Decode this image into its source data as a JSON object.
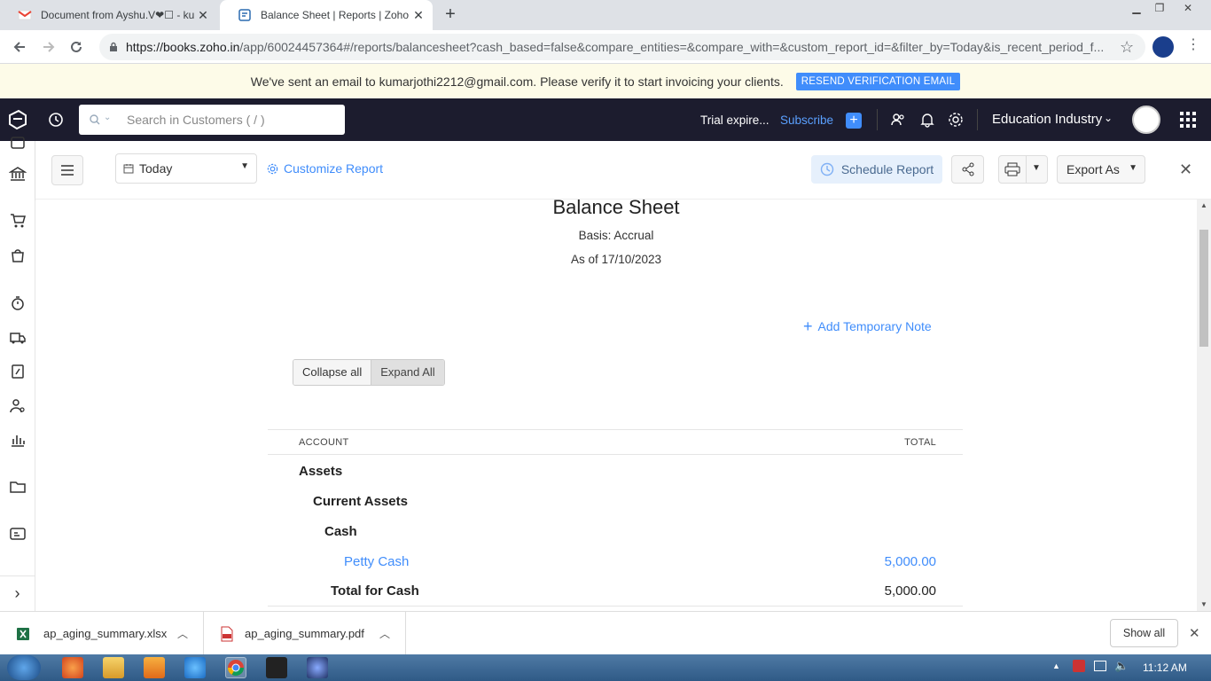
{
  "browser": {
    "tabs": [
      {
        "title": "Document from Ayshu.V❤☐ - ku",
        "active": false
      },
      {
        "title": "Balance Sheet | Reports | Zoho Bo",
        "active": true
      }
    ],
    "url_host": "https://books.zoho.in",
    "url_path": "/app/60024457364#/reports/balancesheet?cash_based=false&compare_entities=&compare_with=&custom_report_id=&filter_by=Today&is_recent_period_f..."
  },
  "banner": {
    "message": "We've sent an email to kumarjothi2212@gmail.com. Please verify it to start invoicing your clients.",
    "button": "RESEND VERIFICATION EMAIL"
  },
  "header": {
    "search_placeholder": "Search in Customers ( / )",
    "trial": "Trial expire...",
    "subscribe": "Subscribe",
    "org": "Education Industry"
  },
  "toolbar": {
    "period": "Today",
    "customize": "Customize Report",
    "schedule": "Schedule Report",
    "export": "Export As"
  },
  "report": {
    "title": "Balance Sheet",
    "basis": "Basis: Accrual",
    "as_of": "As of 17/10/2023",
    "add_note": "Add Temporary Note",
    "collapse_all": "Collapse all",
    "expand_all": "Expand All",
    "col_account": "ACCOUNT",
    "col_total": "TOTAL",
    "rows": [
      {
        "label": "Assets",
        "amount": ""
      },
      {
        "label": "Current Assets",
        "amount": ""
      },
      {
        "label": "Cash",
        "amount": ""
      },
      {
        "label": "Petty Cash",
        "amount": "5,000.00"
      },
      {
        "label": "Total for Cash",
        "amount": "5,000.00"
      }
    ]
  },
  "downloads": {
    "items": [
      "ap_aging_summary.xlsx",
      "ap_aging_summary.pdf"
    ],
    "show_all": "Show all"
  },
  "taskbar": {
    "time": "11:12 AM"
  },
  "colors": {
    "accent": "#408dfb",
    "header_bg": "#1c1c2e",
    "link": "#408dfb"
  }
}
